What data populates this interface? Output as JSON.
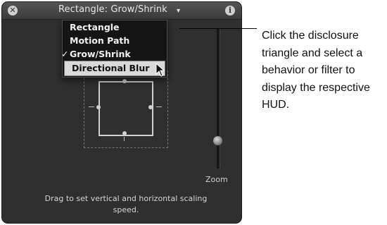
{
  "hud": {
    "title": "Rectangle: Grow/Shrink",
    "title_dropdown_symbol": "▾",
    "close_symbol": "✕",
    "info_symbol": "i",
    "menu": {
      "items": [
        {
          "label": "Rectangle",
          "checked": false,
          "selected": false
        },
        {
          "label": "Motion Path",
          "checked": false,
          "selected": false
        },
        {
          "label": "Grow/Shrink",
          "checked": true,
          "selected": false
        },
        {
          "label": "Directional Blur",
          "checked": false,
          "selected": true
        }
      ],
      "check_symbol": "✓"
    },
    "zoom_label": "Zoom",
    "zoom_level": 0.2,
    "instruction": "Drag to set vertical and horizontal scaling speed."
  },
  "callout": {
    "text": "Click the disclosure triangle and select a behavior or filter to display the respective HUD."
  },
  "colors": {
    "hud_background": "#2f2f2f",
    "menu_background": "#151515",
    "menu_selected": "#d9d9d9"
  },
  "icons": [
    "close-icon",
    "info-icon",
    "disclosure-triangle-icon",
    "pointer-cursor-icon"
  ]
}
